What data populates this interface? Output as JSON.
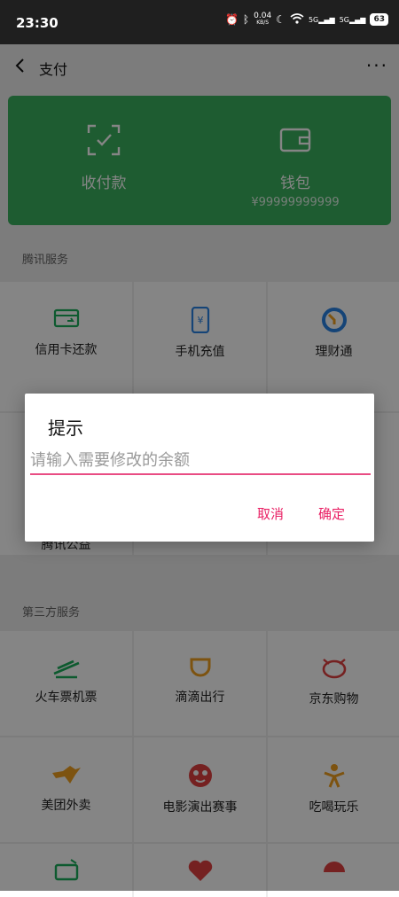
{
  "status_bar": {
    "time": "23:30",
    "net_speed": "0.04",
    "net_unit": "KB/S",
    "signal1": "5G",
    "signal2": "5G",
    "battery": "63"
  },
  "header": {
    "title": "支付"
  },
  "wallet_card": {
    "receive_label": "收付款",
    "wallet_label": "钱包",
    "balance": "¥99999999999"
  },
  "tencent": {
    "title": "腾讯服务",
    "items": [
      {
        "label": "信用卡还款",
        "icon": "credit-card-icon"
      },
      {
        "label": "手机充值",
        "icon": "phone-topup-icon"
      },
      {
        "label": "理财通",
        "icon": "wealth-icon"
      },
      {
        "label": "腾讯公益",
        "icon": "charity-icon"
      }
    ]
  },
  "third_party": {
    "title": "第三方服务",
    "items": [
      {
        "label": "火车票机票",
        "icon": "train-ticket-icon"
      },
      {
        "label": "滴滴出行",
        "icon": "didi-icon"
      },
      {
        "label": "京东购物",
        "icon": "jd-icon"
      },
      {
        "label": "美团外卖",
        "icon": "meituan-icon"
      },
      {
        "label": "电影演出赛事",
        "icon": "movie-icon"
      },
      {
        "label": "吃喝玩乐",
        "icon": "food-fun-icon"
      }
    ]
  },
  "dialog": {
    "title": "提示",
    "placeholder": "请输入需要修改的余额",
    "cancel": "取消",
    "confirm": "确定"
  },
  "colors": {
    "green": "#3bb05e",
    "accent": "#e91e63",
    "icon_green": "#1aad5a",
    "icon_orange": "#f0a020",
    "icon_red": "#e04040",
    "icon_blue": "#2a82e4"
  }
}
